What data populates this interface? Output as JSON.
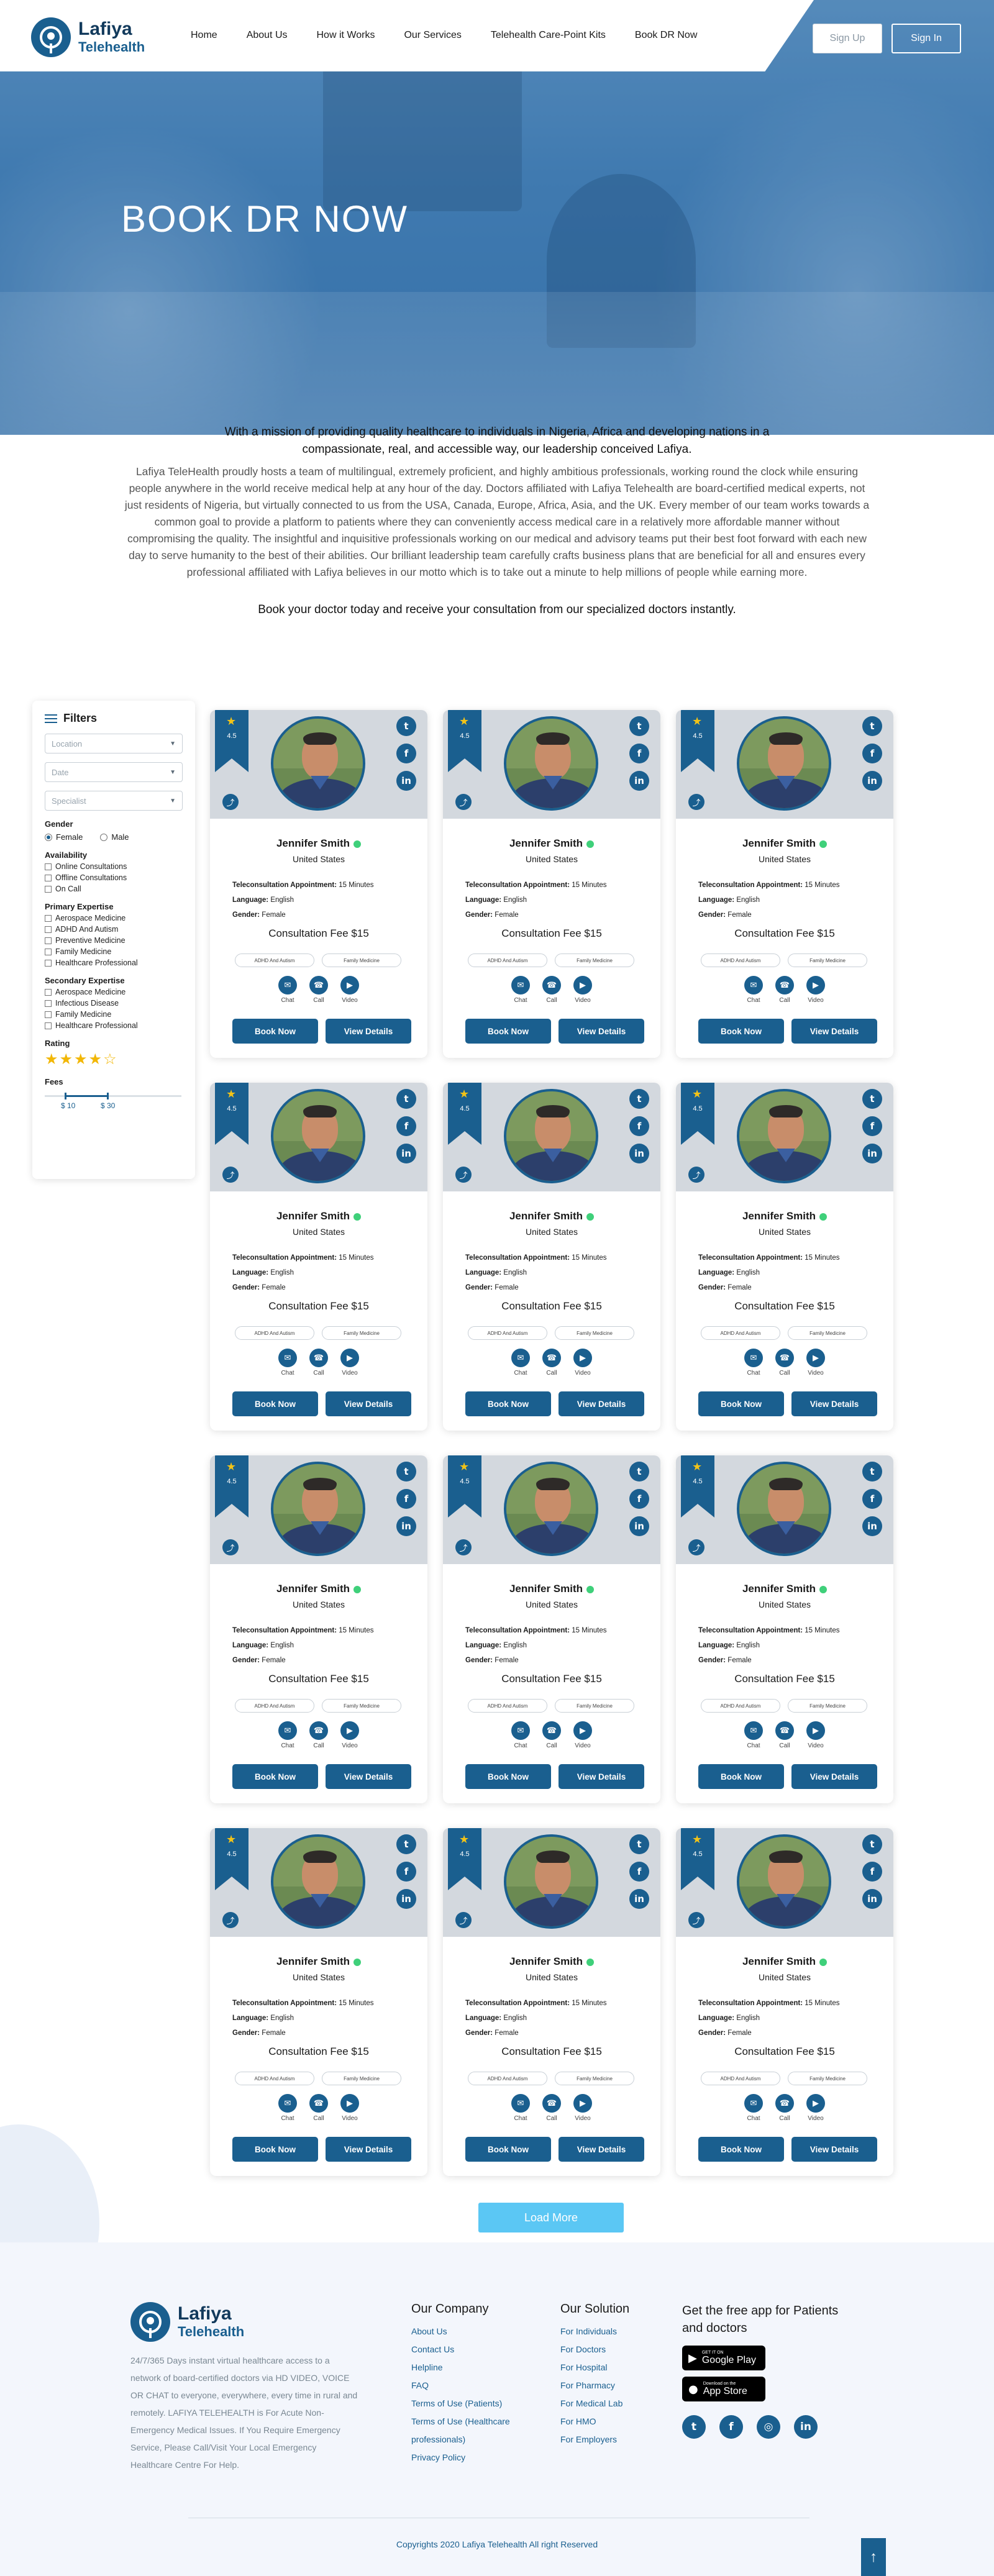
{
  "brand": {
    "name_line1": "Lafiya",
    "name_line2": "Telehealth"
  },
  "nav": {
    "items": [
      "Home",
      "About Us",
      "How it Works",
      "Our Services",
      "Telehealth Care-Point Kits",
      "Book DR Now"
    ],
    "signup": "Sign Up",
    "signin": "Sign In"
  },
  "hero": {
    "title": "BOOK DR NOW"
  },
  "intro": {
    "lead": "With a mission of providing quality healthcare to individuals in Nigeria, Africa and developing nations in a compassionate, real, and accessible way, our leadership conceived Lafiya.",
    "body": "Lafiya TeleHealth proudly hosts a team of multilingual, extremely proficient, and highly ambitious professionals, working round the clock while ensuring people anywhere in the world receive medical help at any hour of the day. Doctors affiliated with Lafiya Telehealth are board-certified medical experts, not just residents of Nigeria, but virtually connected to us from the USA, Canada, Europe, Africa, Asia, and the UK. Every member of our team works towards a common goal to provide a platform to patients where they can conveniently access medical care in a relatively more affordable manner without compromising the quality. The insightful and inquisitive professionals working on our medical and advisory teams put their best foot forward with each new day to serve humanity to the best of their abilities. Our brilliant leadership team carefully crafts business plans that are beneficial for all and ensures every professional affiliated with Lafiya believes in our motto which is to take out a minute to help millions of people while earning more.",
    "cta": "Book your doctor today and receive your consultation from our specialized doctors instantly."
  },
  "filters": {
    "title": "Filters",
    "location_placeholder": "Location",
    "date_placeholder": "Date",
    "specialist_placeholder": "Specialist",
    "gender_label": "Gender",
    "gender_options": [
      "Female",
      "Male"
    ],
    "gender_selected": "Female",
    "availability_label": "Availability",
    "availability": [
      "Online Consultations",
      "Offline Consultations",
      "On Call"
    ],
    "primary_label": "Primary Expertise",
    "primary": [
      "Aerospace Medicine",
      "ADHD And Autism",
      "Preventive Medicine",
      "Family Medicine",
      "Healthcare Professional"
    ],
    "secondary_label": "Secondary Expertise",
    "secondary": [
      "Aerospace Medicine",
      "Infectious Disease",
      "Family Medicine",
      "Healthcare Professional"
    ],
    "rating_label": "Rating",
    "rating_stars": "★★★★☆",
    "fees_label": "Fees",
    "fee_min": "$ 10",
    "fee_max": "$ 30"
  },
  "doctor": {
    "rating": "4.5",
    "name": "Jennifer Smith",
    "country": "United States",
    "appt_label": "Teleconsultation Appointment:",
    "appt_value": "15 Minutes",
    "lang_label": "Language:",
    "lang_value": "English",
    "gender_label": "Gender:",
    "gender_value": "Female",
    "fee": "Consultation Fee $15",
    "tags": [
      "ADHD And Autism",
      "Family Medicine"
    ],
    "actions": [
      "Chat",
      "Call",
      "Video"
    ],
    "book": "Book Now",
    "view": "View Details"
  },
  "icons": {
    "star": "star-icon",
    "share": "share-icon",
    "twitter": "twitter-icon",
    "facebook": "facebook-icon",
    "linkedin": "linkedin-icon",
    "chat": "chat-icon",
    "call": "phone-icon",
    "video": "video-icon"
  },
  "load_more": "Load More",
  "footer": {
    "desc": "24/7/365 Days instant virtual healthcare access to a network of board-certified doctors via HD VIDEO, VOICE OR CHAT to everyone, everywhere, every time in rural and remotely. LAFIYA TELEHEALTH is For Acute Non-Emergency Medical Issues. If You Require Emergency Service, Please Call/Visit Your Local Emergency Healthcare Centre For Help.",
    "company_title": "Our Company",
    "company": [
      "About Us",
      "Contact Us",
      "Helpline",
      "FAQ",
      "Terms of Use (Patients)",
      "Terms of Use (Healthcare professionals)",
      "Privacy Policy"
    ],
    "solution_title": "Our Solution",
    "solution": [
      "For Individuals",
      "For Doctors",
      "For Hospital",
      "For Pharmacy",
      "For Medical Lab",
      "For HMO",
      "For Employers"
    ],
    "app_title": "Get the free app for Patients and doctors",
    "gplay_small": "GET IT ON",
    "gplay_big": "Google Play",
    "appstore_small": "Download on the",
    "appstore_big": "App Store",
    "copyright": "Copyrights 2020 Lafiya Telehealth All right Reserved"
  },
  "colors": {
    "primary": "#1a5f8f",
    "accent": "#5bc7f4",
    "online": "#3fd07a",
    "star": "#f2b705"
  }
}
